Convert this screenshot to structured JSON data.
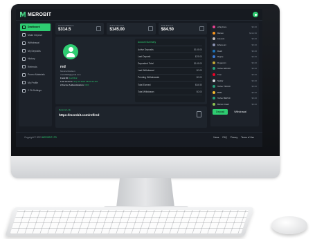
{
  "brand": {
    "name": "MEROBIT"
  },
  "sidebar": {
    "items": [
      {
        "label": "Dashboard",
        "active": true
      },
      {
        "label": "Make Deposit"
      },
      {
        "label": "Withdrawal"
      },
      {
        "label": "My Deposits"
      },
      {
        "label": "History"
      },
      {
        "label": "Referrals"
      },
      {
        "label": "Promo Materials"
      },
      {
        "label": "My Profile"
      },
      {
        "label": "2 FA Settings"
      }
    ]
  },
  "stats": [
    {
      "label": "Account Balance",
      "value": "$314.5"
    },
    {
      "label": "Active Deposits",
      "value": "$145.00"
    },
    {
      "label": "Total Earned",
      "value": "$84.50"
    }
  ],
  "profile": {
    "username": "red",
    "full_name": "Monica Rodison",
    "email": "tmitc2000@gmail.com",
    "fund_label": "Fund ID:",
    "fund_value": "1121512",
    "last_access_label": "Last Access:",
    "last_access_value": "Sep 10 2023 08:00:44 AM",
    "twofa_label": "2-Factor Authentication:",
    "twofa_value": "OFF"
  },
  "summary": {
    "title": "Account Summary",
    "rows": [
      {
        "label": "Active Deposits",
        "value": "$145.00"
      },
      {
        "label": "Last Deposit",
        "value": "$25.00"
      },
      {
        "label": "Deposited Total",
        "value": "$145.00"
      },
      {
        "label": "Last Withdrawal",
        "value": "$0.00"
      },
      {
        "label": "Pending Withdrawals",
        "value": "$0.00"
      },
      {
        "label": "Total Earned",
        "value": "$84.50"
      },
      {
        "label": "Total Withdrawn",
        "value": "$0.00"
      }
    ]
  },
  "referral": {
    "label": "Referral Link",
    "url": "https://merobit.com/ref/red"
  },
  "wallets": [
    {
      "name": "ePayCore",
      "amount": "$0.00",
      "color": "#e84393"
    },
    {
      "name": "Bitcoin",
      "amount": "$314.50",
      "color": "#f7931a"
    },
    {
      "name": "Litecoin",
      "amount": "$0.00",
      "color": "#bfbbbb"
    },
    {
      "name": "Ethereum",
      "amount": "$0.00",
      "color": "#8a92b2"
    },
    {
      "name": "Dash",
      "amount": "$0.00",
      "color": "#1c75bc"
    },
    {
      "name": "Ripple",
      "amount": "$0.00",
      "color": "#3a7bd5"
    },
    {
      "name": "Dogecoin",
      "amount": "$0.00",
      "color": "#c2a633"
    },
    {
      "name": "Tether ERC20",
      "amount": "$0.00",
      "color": "#26a17b"
    },
    {
      "name": "Tron",
      "amount": "$0.00",
      "color": "#ef0027"
    },
    {
      "name": "Stellar",
      "amount": "$0.00",
      "color": "#d0d4d8"
    },
    {
      "name": "Tether TRC20",
      "amount": "$0.00",
      "color": "#26a17b"
    },
    {
      "name": "BNB",
      "amount": "$0.00",
      "color": "#f3ba2f"
    },
    {
      "name": "Tether BEP20",
      "amount": "$0.00",
      "color": "#26a17b"
    },
    {
      "name": "Bitcoin Cash",
      "amount": "$0.00",
      "color": "#8dc351"
    }
  ],
  "actions": {
    "deposit": "Deposit",
    "withdrawal": "Withdrawal"
  },
  "footer": {
    "copyright_prefix": "Copyright © 2023",
    "copyright_brand": "MEROBIT LTD",
    "links": [
      "News",
      "FAQ",
      "Privacy",
      "Terms of Use"
    ]
  }
}
